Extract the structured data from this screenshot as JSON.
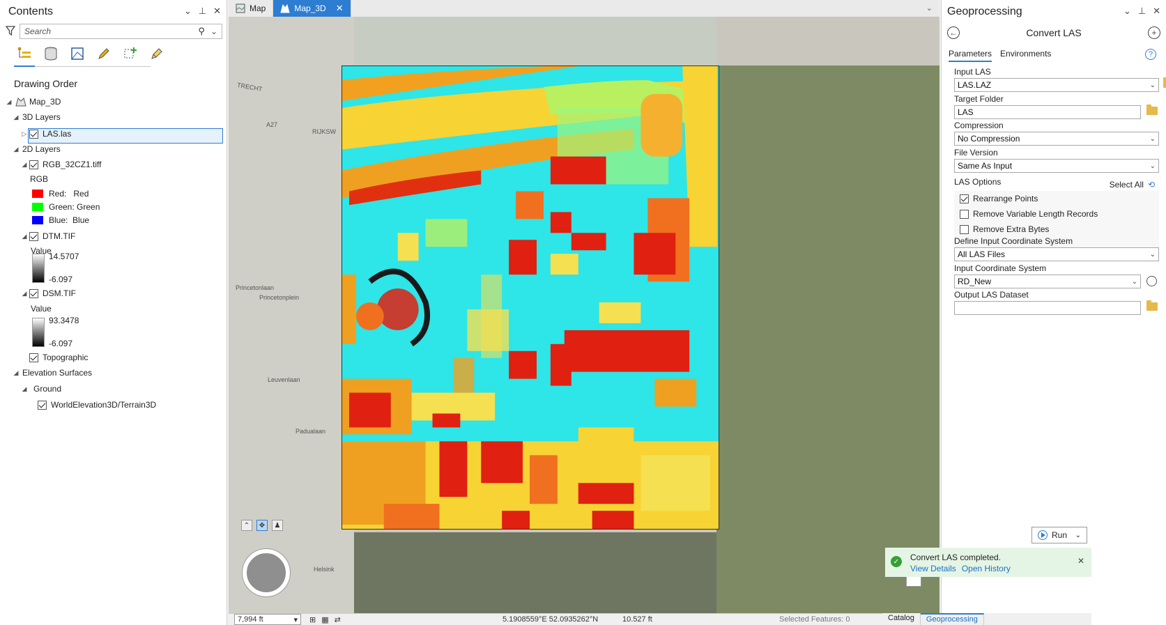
{
  "contents": {
    "title": "Contents",
    "search_placeholder": "Search",
    "drawing_order": "Drawing Order",
    "map_name": "Map_3D",
    "group_3d": "3D Layers",
    "las_layer": "LAS.las",
    "group_2d": "2D Layers",
    "rgb_layer": "RGB_32CZ1.tiff",
    "rgb_label": "RGB",
    "bands": [
      {
        "label": "Red:   Red",
        "color": "#ff0000"
      },
      {
        "label": "Green: Green",
        "color": "#00ff00"
      },
      {
        "label": "Blue:  Blue",
        "color": "#0000ff"
      }
    ],
    "dtm_layer": "DTM.TIF",
    "dtm_value_label": "Value",
    "dtm_max": "14.5707",
    "dtm_min": "-6.097",
    "dsm_layer": "DSM.TIF",
    "dsm_value_label": "Value",
    "dsm_max": "93.3478",
    "dsm_min": "-6.097",
    "topographic": "Topographic",
    "elevation_surfaces": "Elevation Surfaces",
    "ground": "Ground",
    "terrain": "WorldElevation3D/Terrain3D"
  },
  "map_tabs": [
    {
      "label": "Map"
    },
    {
      "label": "Map_3D"
    }
  ],
  "map_labels": {
    "l1": "TRECHT",
    "l2": "Princetonlaan",
    "l3": "Princetonplein",
    "l4": "Leuvenlaan",
    "l5": "Padualaan",
    "l6": "Helsink",
    "l7": "RIJKSW",
    "l8": "A27"
  },
  "statusbar": {
    "scale": "7,994 ft",
    "coords": "5.1908559°E 52.0935262°N",
    "elevation": "10.527 ft",
    "selected": "Selected Features: 0"
  },
  "geo": {
    "title": "Geoprocessing",
    "tool_name": "Convert LAS",
    "tab_parameters": "Parameters",
    "tab_environments": "Environments",
    "input_las_label": "Input LAS",
    "input_las_value": "LAS.LAZ",
    "target_folder_label": "Target Folder",
    "target_folder_value": "LAS",
    "compression_label": "Compression",
    "compression_value": "No Compression",
    "file_version_label": "File Version",
    "file_version_value": "Same As Input",
    "las_options_label": "LAS Options",
    "select_all": "Select All",
    "opt1": "Rearrange Points",
    "opt2": "Remove Variable Length Records",
    "opt3": "Remove Extra Bytes",
    "define_cs_label": "Define Input Coordinate System",
    "define_cs_value": "All LAS Files",
    "input_cs_label": "Input Coordinate System",
    "input_cs_value": "RD_New",
    "output_label": "Output LAS Dataset",
    "output_value": "",
    "run": "Run",
    "success_msg": "Convert LAS completed.",
    "view_details": "View Details",
    "open_history": "Open History"
  },
  "bottom_tabs": {
    "catalog": "Catalog",
    "geoprocessing": "Geoprocessing"
  }
}
